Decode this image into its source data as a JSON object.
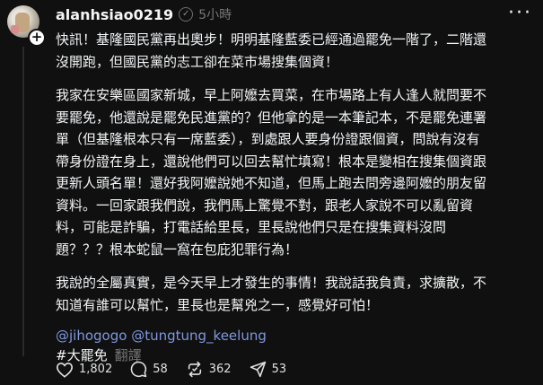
{
  "post": {
    "username": "alanhsiao0219",
    "time": "5小時",
    "paragraphs": [
      "快訊！基隆國民黨再出奧步！明明基隆藍委已經通過罷免一階了，二階還\n沒開跑，但國民黨的志工卻在菜市場搜集個資！",
      "我家在安樂區國家新城，早上阿嬤去買菜，在市場路上有人逢人就問要不\n要罷免，他還說是罷免民進黨的？但他拿的是一本筆記本，不是罷免連署\n單（但基隆根本只有一席藍委），到處跟人要身份證跟個資，問說有沒有\n帶身份證在身上，還說他們可以回去幫忙填寫！根本是變相在搜集個資跟\n更新人頭名單！還好我阿嬤說她不知道，但馬上跑去問旁邊阿嬤的朋友留\n資料。一回家跟我們說，我們馬上驚覺不對，跟老人家說不可以亂留資\n料，可能是詐騙，打電話給里長，里長說他們只是在搜集資料沒問\n題？？？根本蛇鼠一窩在包庇犯罪行為！",
      "我說的全屬真實，是今天早上才發生的事情！我說話我負責，求擴散，不\n知道有誰可以幫忙，里長也是幫兇之一，感覺好可怕！"
    ],
    "mentions": [
      "@jihogogo",
      "@tungtung_keelung"
    ],
    "hashtag": "#大罷免",
    "translate": "翻譯",
    "counts": {
      "likes": "1,802",
      "comments": "58",
      "reposts": "362",
      "shares": "53"
    }
  },
  "colors": {
    "background": "#101010",
    "text": "#f3f5f7",
    "muted": "#777777",
    "link": "#7f98e0"
  },
  "icons": [
    "avatar",
    "plus-icon",
    "verified-icon",
    "more-icon",
    "heart-icon",
    "comment-icon",
    "repost-icon",
    "share-icon"
  ]
}
